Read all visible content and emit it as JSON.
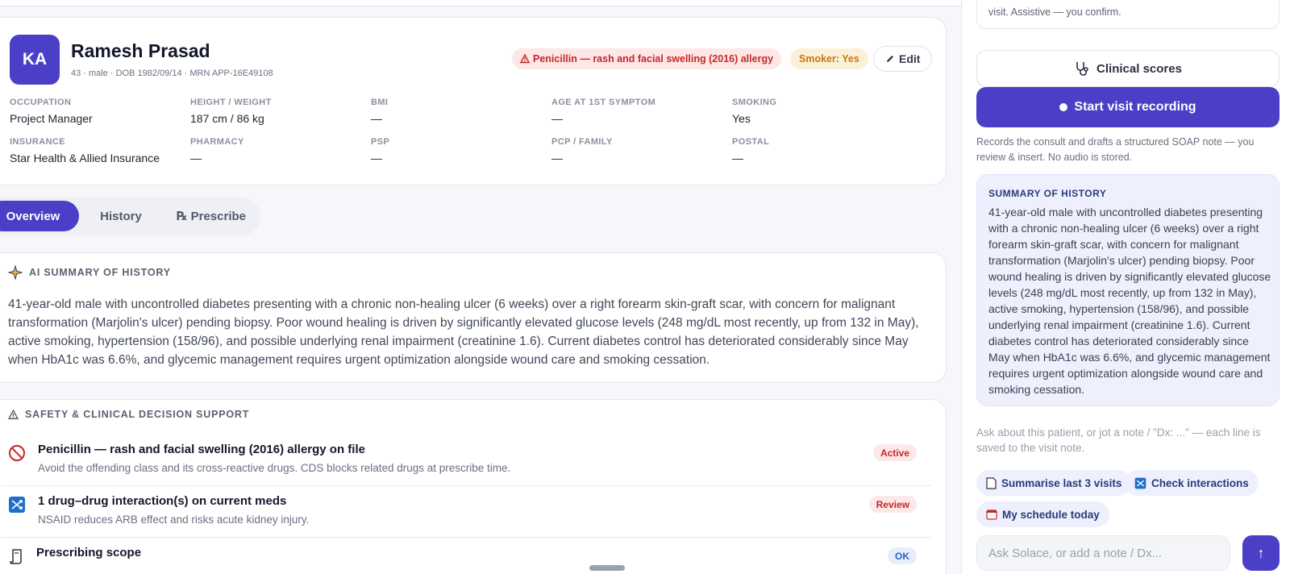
{
  "patient": {
    "initials": "KA",
    "name": "Ramesh Prasad",
    "meta": "43 · male · DOB 1982/09/14 · MRN APP-16E49108",
    "allergy_badge": "Penicillin — rash and facial swelling (2016) allergy",
    "smoker_badge": "Smoker: Yes",
    "edit_label": "Edit",
    "fields": [
      {
        "label": "OCCUPATION",
        "value": "Project Manager"
      },
      {
        "label": "HEIGHT / WEIGHT",
        "value": "187 cm / 86 kg"
      },
      {
        "label": "BMI",
        "value": "—"
      },
      {
        "label": "AGE AT 1ST SYMPTOM",
        "value": "—"
      },
      {
        "label": "SMOKING",
        "value": "Yes"
      },
      {
        "label": "INSURANCE",
        "value": "Star Health & Allied Insurance"
      },
      {
        "label": "PHARMACY",
        "value": "—"
      },
      {
        "label": "PSP",
        "value": "—"
      },
      {
        "label": "PCP / FAMILY",
        "value": "—"
      },
      {
        "label": "POSTAL",
        "value": "—"
      }
    ]
  },
  "tabs": [
    {
      "label": "Overview"
    },
    {
      "label": "History"
    },
    {
      "label": "℞ Prescribe"
    }
  ],
  "ai_summary": {
    "title": "AI SUMMARY OF HISTORY",
    "text": "41-year-old male with uncontrolled diabetes presenting with a chronic non-healing ulcer (6 weeks) over a right forearm skin-graft scar, with concern for malignant transformation (Marjolin's ulcer) pending biopsy. Poor wound healing is driven by significantly elevated glucose levels (248 mg/dL most recently, up from 132 in May), active smoking, hypertension (158/96), and possible underlying renal impairment (creatinine 1.6). Current diabetes control has deteriorated considerably since May when HbA1c was 6.6%, and glycemic management requires urgent optimization alongside wound care and smoking cessation."
  },
  "safety": {
    "title": "SAFETY & CLINICAL DECISION SUPPORT",
    "rows": [
      {
        "title": "Penicillin — rash and facial swelling (2016) allergy on file",
        "sub": "Avoid the offending class and its cross-reactive drugs. CDS blocks related drugs at prescribe time.",
        "status": "Active"
      },
      {
        "title": "1 drug–drug interaction(s) on current meds",
        "sub": "NSAID reduces ARB effect and risks acute kidney injury.",
        "status": "Review"
      },
      {
        "title": "Prescribing scope",
        "sub": "",
        "status": "OK"
      }
    ]
  },
  "right_panel": {
    "top_text": "visit. Assistive — you confirm.",
    "scores_label": "Clinical scores",
    "record_label": "Start visit recording",
    "record_note": "Records the consult and drafts a structured SOAP note — you review & insert. No audio is stored.",
    "summary_title": "SUMMARY OF HISTORY",
    "summary_text": "41-year-old male with uncontrolled diabetes presenting with a chronic non-healing ulcer (6 weeks) over a right forearm skin-graft scar, with concern for malignant transformation (Marjolin's ulcer) pending biopsy. Poor wound healing is driven by significantly elevated glucose levels (248 mg/dL most recently, up from 132 in May), active smoking, hypertension (158/96), and possible underlying renal impairment (creatinine 1.6). Current diabetes control has deteriorated considerably since May when HbA1c was 6.6%, and glycemic management requires urgent optimization alongside wound care and smoking cessation.",
    "ask_note": "Ask about this patient, or jot a note / \"Dx: ...\" — each line is saved to the visit note.",
    "chips": [
      {
        "label": "Summarise last 3 visits",
        "icon": "document-icon"
      },
      {
        "label": "Check interactions",
        "icon": "interaction-icon"
      },
      {
        "label": "My schedule today",
        "icon": "calendar-icon"
      }
    ],
    "input_placeholder": "Ask Solace, or add a note / Dx...",
    "send_icon": "↑"
  },
  "colors": {
    "accent": "#4a3fc6",
    "danger": "#c62828",
    "warning": "#c7790b",
    "info": "#2f62c6"
  }
}
